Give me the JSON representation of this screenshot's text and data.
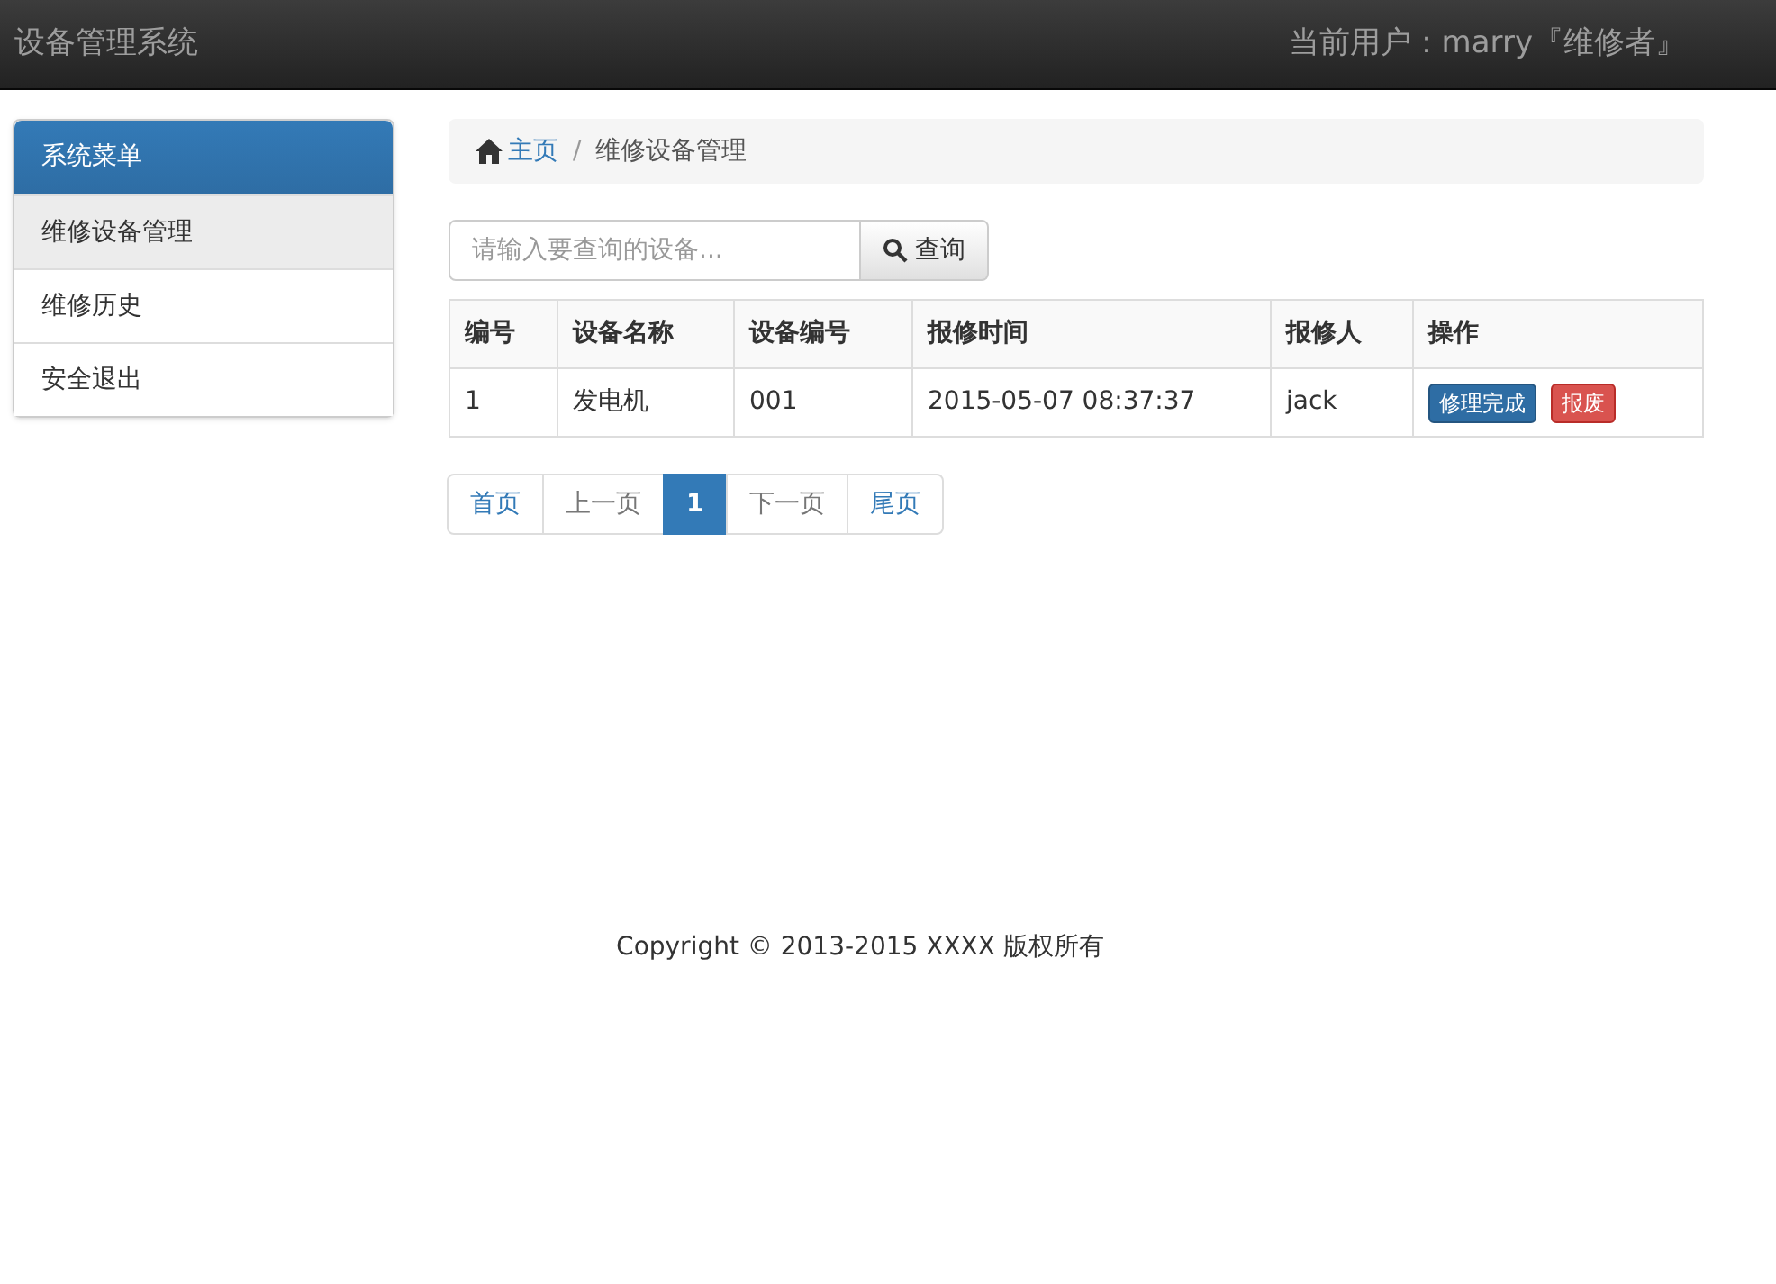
{
  "navbar": {
    "brand": "设备管理系统",
    "user": "当前用户：marry『维修者』"
  },
  "sidebar": {
    "title": "系统菜单",
    "items": [
      {
        "label": "维修设备管理",
        "selected": true
      },
      {
        "label": "维修历史",
        "selected": false
      },
      {
        "label": "安全退出",
        "selected": false
      }
    ]
  },
  "breadcrumb": [
    {
      "label": "主页",
      "kind": "home"
    },
    {
      "label": "/",
      "kind": "separator"
    },
    {
      "label": "维修设备管理",
      "kind": "current"
    }
  ],
  "search": {
    "placeholder": "请输入要查询的设备...",
    "button": "查询"
  },
  "table": {
    "columns": [
      "编号",
      "设备名称",
      "设备编号",
      "报修时间",
      "报修人",
      "操作"
    ],
    "rows": [
      {
        "cells": [
          "1",
          "发电机",
          "001",
          "2015-05-07 08:37:37",
          "jack"
        ],
        "actions": [
          {
            "label": "修理完成",
            "kind": "primary"
          },
          {
            "label": "报废",
            "kind": "danger"
          }
        ]
      }
    ]
  },
  "pagination": [
    {
      "label": "首页",
      "selected": false,
      "disabled": false
    },
    {
      "label": "上一页",
      "selected": false,
      "disabled": true
    },
    {
      "label": "1",
      "selected": true,
      "disabled": false
    },
    {
      "label": "下一页",
      "selected": false,
      "disabled": true
    },
    {
      "label": "尾页",
      "selected": false,
      "disabled": false
    }
  ],
  "footer": "Copyright © 2013-2015 XXXX 版权所有"
}
